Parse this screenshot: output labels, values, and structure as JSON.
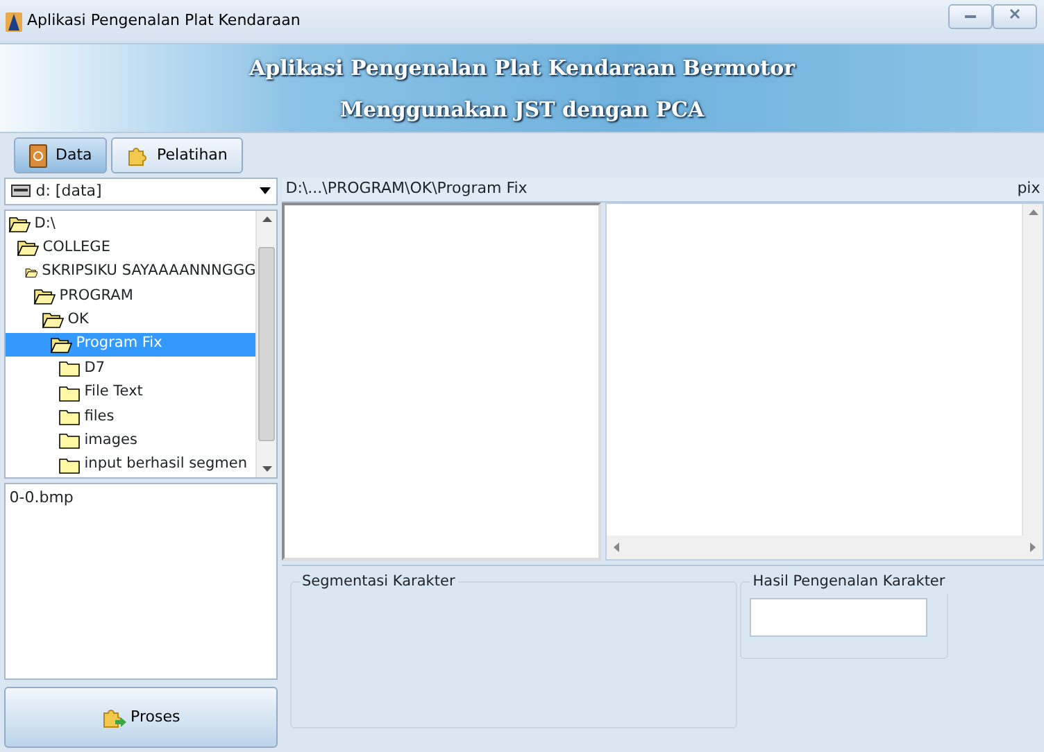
{
  "window": {
    "title": "Aplikasi Pengenalan Plat Kendaraan"
  },
  "header": {
    "title": "Aplikasi Pengenalan Plat Kendaraan Bermotor",
    "subtitle": "Menggunakan JST dengan PCA"
  },
  "tabs": [
    {
      "label": "Data",
      "selected": true
    },
    {
      "label": "Pelatihan",
      "selected": false
    }
  ],
  "drive": {
    "value": "d: [data]"
  },
  "tree": [
    {
      "label": "D:\\",
      "expanded": true,
      "selected": false,
      "children": [
        {
          "label": "COLLEGE",
          "expanded": true,
          "selected": false,
          "children": [
            {
              "label": "SKRIPSIKU SAYAAAANNNGGG",
              "expanded": true,
              "selected": false,
              "children": [
                {
                  "label": "PROGRAM",
                  "expanded": true,
                  "selected": false,
                  "children": [
                    {
                      "label": "OK",
                      "expanded": true,
                      "selected": false,
                      "children": [
                        {
                          "label": "Program Fix",
                          "expanded": true,
                          "selected": true,
                          "children": [
                            {
                              "label": "D7",
                              "expanded": false,
                              "selected": false
                            },
                            {
                              "label": "File Text",
                              "expanded": false,
                              "selected": false
                            },
                            {
                              "label": "files",
                              "expanded": false,
                              "selected": false
                            },
                            {
                              "label": "images",
                              "expanded": false,
                              "selected": false
                            },
                            {
                              "label": "input berhasil segmen",
                              "expanded": false,
                              "selected": false
                            }
                          ]
                        }
                      ]
                    }
                  ]
                }
              ]
            }
          ]
        }
      ]
    }
  ],
  "files": [
    "0-0.bmp"
  ],
  "process_button": "Proses",
  "path": "D:\\...\\PROGRAM\\OK\\Program Fix",
  "path_right": "pix",
  "segmentation": {
    "title": "Segmentasi Karakter"
  },
  "result": {
    "title": "Hasil Pengenalan Karakter"
  }
}
